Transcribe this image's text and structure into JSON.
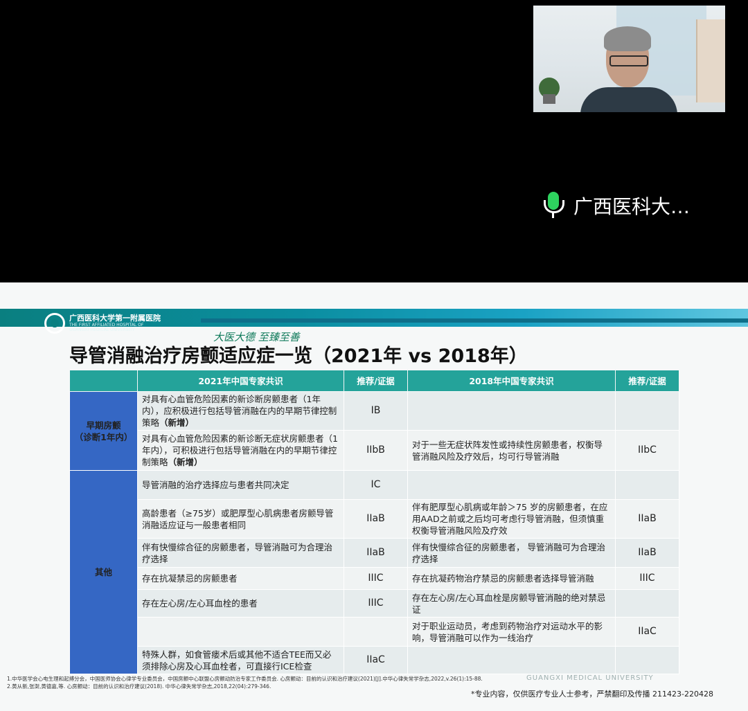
{
  "speaker": {
    "name": "广西医科大…"
  },
  "slide": {
    "hospital_cn": "广西医科大学第一附属医院",
    "hospital_en_1": "THE FIRST AFFILIATED HOSPITAL OF",
    "hospital_en_2": "GUANGXI MEDICAL UNIVERSITY",
    "motto": "大医大德 至臻至善",
    "title": "导管消融治疗房颤适应症一览（2021年 vs 2018年）",
    "headers": {
      "cat": "",
      "c2021": "2021年中国专家共识",
      "ev2021": "推荐/证据",
      "c2018": "2018年中国专家共识",
      "ev2018": "推荐/证据"
    },
    "categories": {
      "early": "早期房颤\n（诊断1年内）",
      "other": "其他"
    },
    "rows": [
      {
        "t2021": "对具有心血管危险因素的新诊断房颤患者（1年内），应积极进行包括导管消融在内的早期节律控制策略",
        "new": "（新增）",
        "ev2021": "IB",
        "t2018": "",
        "ev2018": ""
      },
      {
        "t2021": "对具有心血管危险因素的新诊断无症状房颤患者（1年内），可积极进行包括导管消融在内的早期节律控制策略",
        "new": "（新增）",
        "ev2021": "IIbB",
        "t2018": "对于一些无症状阵发性或持续性房颤患者，权衡导管消融风险及疗效后，均可行导管消融",
        "ev2018": "IIbC"
      },
      {
        "t2021": "导管消融的治疗选择应与患者共同决定",
        "ev2021": "IC",
        "t2018": "",
        "ev2018": ""
      },
      {
        "t2021": "高龄患者（≥75岁）或肥厚型心肌病患者房颤导管消融适应证与一般患者相同",
        "ev2021": "IIaB",
        "t2018": "伴有肥厚型心肌病或年龄＞75 岁的房颤患者，在应用AAD之前或之后均可考虑行导管消融，但须慎重权衡导管消融风险及疗效",
        "ev2018": "IIaB"
      },
      {
        "t2021": "伴有快慢综合征的房颤患者，导管消融可为合理治疗选择",
        "ev2021": "IIaB",
        "t2018": "伴有快慢综合征的房颤患者， 导管消融可为合理治疗选择",
        "ev2018": "IIaB"
      },
      {
        "t2021": "存在抗凝禁忌的房颤患者",
        "ev2021": "IIIC",
        "t2018": "存在抗凝药物治疗禁忌的房颤患者选择导管消融",
        "ev2018": "IIIC"
      },
      {
        "t2021": "存在左心房/左心耳血栓的患者",
        "ev2021": "IIIC",
        "t2018": "存在左心房/左心耳血栓是房颤导管消融的绝对禁忌证",
        "ev2018": ""
      },
      {
        "t2021": "",
        "ev2021": "",
        "t2018": "对于职业运动员，考虑到药物治疗对运动水平的影响，导管消融可以作为一线治疗",
        "ev2018": "IIaC"
      },
      {
        "t2021": "特殊人群，如食管瘘术后或其他不适合TEE而又必须排除心房及心耳血栓者，可直接行ICE检查",
        "ev2021": "IIaC",
        "t2018": "",
        "ev2018": ""
      }
    ],
    "footnote_1": "1.中华医学会心电生理和起搏分会，中国医师协会心律学专业委员会，中国房颤中心联盟心房颤动防治专家工作委员会. 心房颤动：目前的认识和治疗建议(2021)[J].中华心律失常学杂志,2022,v.26(1):15-88.",
    "footnote_2": "2.黄从新,张澍,黄德嘉,等. 心房颤动：目前的认识和治疗建议(2018). 中华心律失常学杂志,2018,22(04):279-346.",
    "watermark": "GUANGXI MEDICAL UNIVERSITY",
    "disclaimer": "*专业内容，仅供医疗专业人士参考，严禁翻印及传播 211423-220428"
  }
}
